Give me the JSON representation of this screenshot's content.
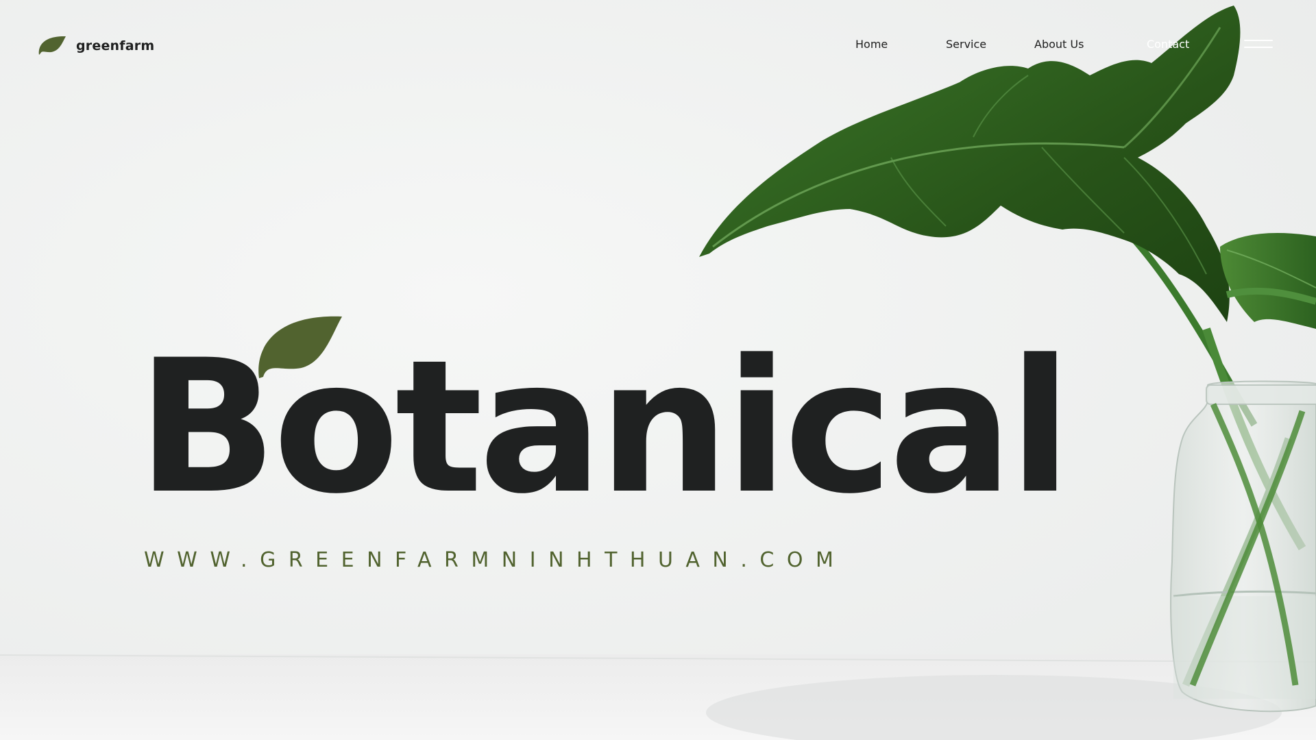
{
  "brand": {
    "name": "greenfarm",
    "icon": "leaf-icon"
  },
  "nav": {
    "items": [
      {
        "label": "Home"
      },
      {
        "label": "Service"
      },
      {
        "label": "About Us"
      },
      {
        "label": "Contact"
      }
    ],
    "menu_icon": "hamburger-menu-icon"
  },
  "hero": {
    "title": "Botanical",
    "url": "WWW.GREENFARMNINHTHUAN.COM",
    "accent_icon": "leaf-icon"
  },
  "colors": {
    "accent_green": "#51632f",
    "title_text": "#1f2121",
    "background": "#f1f2f1",
    "plant_green": "#2c5d1c"
  }
}
